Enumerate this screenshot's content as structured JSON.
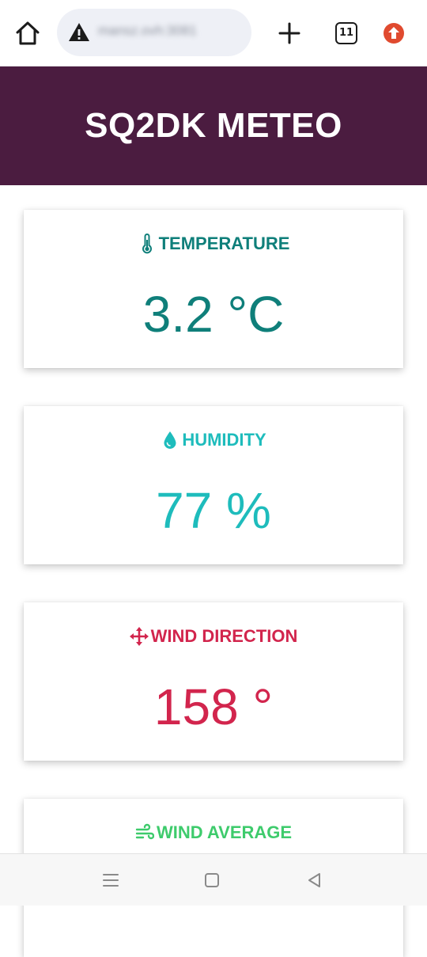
{
  "browser": {
    "url": "mansz.ovh:3081",
    "tab_count": "11",
    "icons": {
      "home": "home-icon",
      "warning": "not-secure-warning-icon",
      "new_tab": "plus-icon",
      "update": "update-arrow-icon"
    },
    "update_color": "#e04a2f"
  },
  "header": {
    "title": "SQ2DK METEO",
    "background": "#4b1c40"
  },
  "cards": [
    {
      "label": "TEMPERATURE",
      "value": "3.2 °C",
      "icon": "thermometer-icon",
      "color": "#0f7f7a"
    },
    {
      "label": "HUMIDITY",
      "value": "77 %",
      "icon": "water-drop-icon",
      "color": "#1ebcbc"
    },
    {
      "label": "WIND DIRECTION",
      "value": "158 °",
      "icon": "arrows-move-icon",
      "color": "#d2254d"
    },
    {
      "label": "WIND AVERAGE",
      "value": "",
      "icon": "wind-icon",
      "color": "#3ecb6c"
    }
  ],
  "system_nav": {
    "icons": [
      "menu-icon",
      "home-square-icon",
      "back-triangle-icon"
    ]
  }
}
